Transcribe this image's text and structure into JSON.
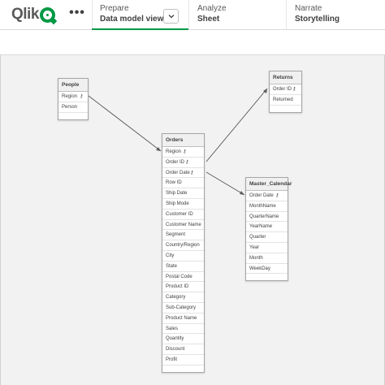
{
  "app": {
    "logo_text": "Qlik",
    "more_label": "•••"
  },
  "tabs": [
    {
      "step": "Prepare",
      "name": "Data model viewer",
      "active": true,
      "has_dropdown": true
    },
    {
      "step": "Analyze",
      "name": "Sheet",
      "active": false
    },
    {
      "step": "Narrate",
      "name": "Storytelling",
      "active": false
    }
  ],
  "key_icon": "key-icon",
  "accent_color": "#009845",
  "tables": {
    "people": {
      "name": "People",
      "fields": [
        {
          "label": "Region",
          "key": true
        },
        {
          "label": "Person",
          "key": false
        }
      ]
    },
    "returns": {
      "name": "Returns",
      "fields": [
        {
          "label": "Order ID",
          "key": true
        },
        {
          "label": "Returned",
          "key": false
        }
      ]
    },
    "orders": {
      "name": "Orders",
      "fields": [
        {
          "label": "Region",
          "key": true
        },
        {
          "label": "Order ID",
          "key": true
        },
        {
          "label": "Order Date",
          "key": true
        },
        {
          "label": "Row ID",
          "key": false
        },
        {
          "label": "Ship Date",
          "key": false
        },
        {
          "label": "Ship Mode",
          "key": false
        },
        {
          "label": "Customer ID",
          "key": false
        },
        {
          "label": "Customer Name",
          "key": false
        },
        {
          "label": "Segment",
          "key": false
        },
        {
          "label": "Country/Region",
          "key": false
        },
        {
          "label": "City",
          "key": false
        },
        {
          "label": "State",
          "key": false
        },
        {
          "label": "Postal Code",
          "key": false
        },
        {
          "label": "Product ID",
          "key": false
        },
        {
          "label": "Category",
          "key": false
        },
        {
          "label": "Sub-Category",
          "key": false
        },
        {
          "label": "Product Name",
          "key": false
        },
        {
          "label": "Sales",
          "key": false
        },
        {
          "label": "Quantity",
          "key": false
        },
        {
          "label": "Discount",
          "key": false
        },
        {
          "label": "Profit",
          "key": false
        }
      ]
    },
    "master_calendar": {
      "name": "Master_Calendar",
      "fields": [
        {
          "label": "Order Date",
          "key": true
        },
        {
          "label": "MonthName",
          "key": false
        },
        {
          "label": "QuarterName",
          "key": false
        },
        {
          "label": "YearName",
          "key": false
        },
        {
          "label": "Quarter",
          "key": false
        },
        {
          "label": "Year",
          "key": false
        },
        {
          "label": "Month",
          "key": false
        },
        {
          "label": "WeekDay",
          "key": false
        }
      ]
    }
  },
  "associations": [
    {
      "from": "People.Region",
      "to": "Orders.Region"
    },
    {
      "from": "Returns.Order ID",
      "to": "Orders.Order ID"
    },
    {
      "from": "Master_Calendar.Order Date",
      "to": "Orders.Order Date"
    }
  ]
}
